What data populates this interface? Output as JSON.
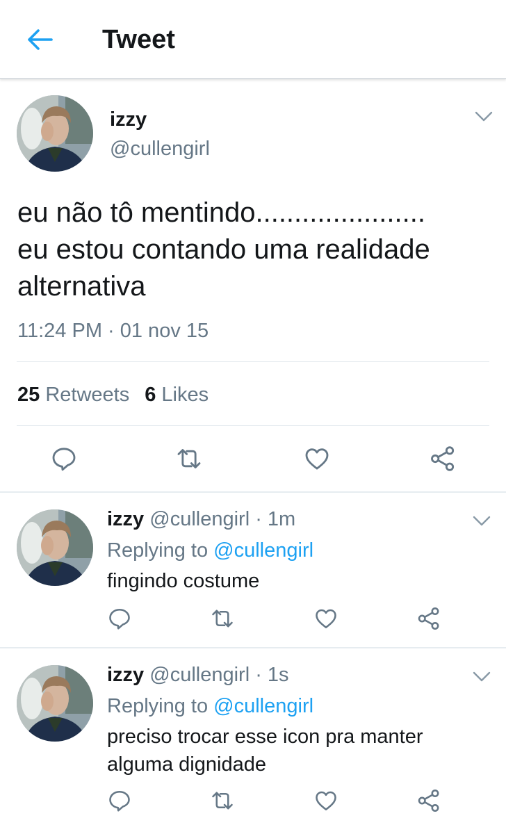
{
  "header": {
    "title": "Tweet",
    "back_icon": "arrow-left-icon",
    "accent": "#1da1f2"
  },
  "tweet": {
    "name": "izzy",
    "handle": "@cullengirl",
    "text_lines": [
      "eu não tô mentindo......................",
      "eu estou contando uma realidade",
      "alternativa"
    ],
    "timestamp": "11:24 PM · 01 nov 15",
    "retweet_count": "25",
    "retweet_label": "Retweets",
    "like_count": "6",
    "like_label": "Likes",
    "actions": [
      "reply-icon",
      "retweet-icon",
      "like-icon",
      "share-icon"
    ]
  },
  "replies": [
    {
      "name": "izzy",
      "handle": "@cullengirl",
      "time": "· 1m",
      "replying_label": "Replying to",
      "replying_to": "@cullengirl",
      "text": "fingindo costume"
    },
    {
      "name": "izzy",
      "handle": "@cullengirl",
      "time": "· 1s",
      "replying_label": "Replying to",
      "replying_to": "@cullengirl",
      "text": "preciso trocar esse icon pra manter alguma dignidade"
    }
  ],
  "colors": {
    "text": "#14171a",
    "secondary": "#657786",
    "link": "#1da1f2",
    "divider": "#e1e8ed"
  }
}
